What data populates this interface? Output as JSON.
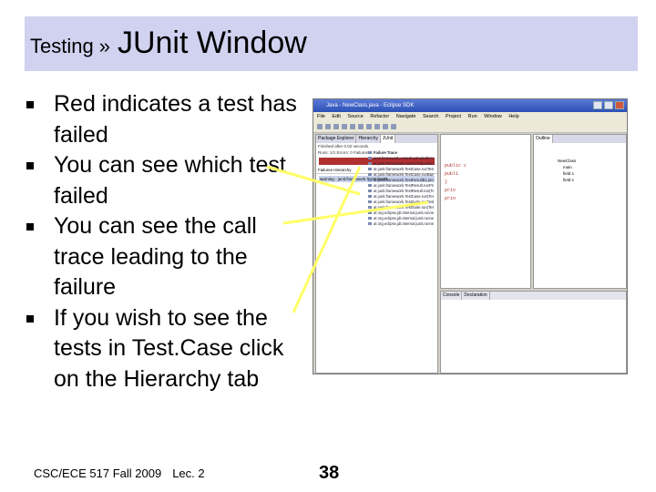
{
  "slide": {
    "title_small": "Testing",
    "title_separator": "»",
    "title_big": "JUnit Window",
    "bullets": [
      "Red indicates a test has failed",
      "You can see which test failed",
      "You can see the call trace leading to the failure",
      "If you wish to see the tests in Test.Case click on the Hierarchy tab"
    ],
    "footer_course": "CSC/ECE 517 Fall 2009",
    "footer_lecture": "Lec. 2",
    "page_number": "38"
  },
  "screenshot": {
    "window_title": "Java - NewClass.java - Eclipse SDK",
    "menu": [
      "File",
      "Edit",
      "Source",
      "Refactor",
      "Navigate",
      "Search",
      "Project",
      "Run",
      "Window",
      "Help"
    ],
    "left_tabs": [
      "Package Explorer",
      "Hierarchy",
      "JUnit"
    ],
    "status": "Finished after 0.02 seconds",
    "counts": "Runs: 1/1   Errors: 0   Failures: 1",
    "sub_tabs": [
      "Failures",
      "Hierarchy"
    ],
    "failed_test": "warning - junit.framework.TestSuite$1",
    "trace_header": "Failure Trace",
    "trace": [
      "junit.framework.AssertionFailedError: No tests fo",
      "at junit.framework.Assert.fail(Assert.java:47)",
      "at junit.framework.TestCase.runTest(TestCase.java",
      "at junit.framework.TestCase.runBare(TestCase.java",
      "at junit.framework.TestResult$1.protect(TestResult",
      "at junit.framework.TestResult.runProtected(TestR",
      "at junit.framework.TestResult.run(TestResult.java",
      "at junit.framework.TestCase.run(TestCase.java:11",
      "at junit.framework.TestSuite.runTest(TestSuite.ja",
      "at junit.framework.TestSuite.run(TestSuite.java:2",
      "at org.eclipse.jdt.internal.junit.runner.RemoteTe",
      "at org.eclipse.jdt.internal.junit.runner.RemoteTe",
      "at org.eclipse.jdt.internal.junit.runner.RemoteTe"
    ],
    "editor_code": [
      "public c",
      "  publi",
      "",
      "  }",
      "  priv",
      "  prin"
    ],
    "right_tabs": [
      "Outline"
    ],
    "right_items": [
      "NewClass",
      "main",
      "field s",
      "field s"
    ],
    "bottom_tabs": [
      "Console",
      "Declaration"
    ],
    "colors": {
      "fail_bar": "#b03030",
      "title_bar": "#d1d1f0",
      "callout": "#ffff66"
    }
  }
}
